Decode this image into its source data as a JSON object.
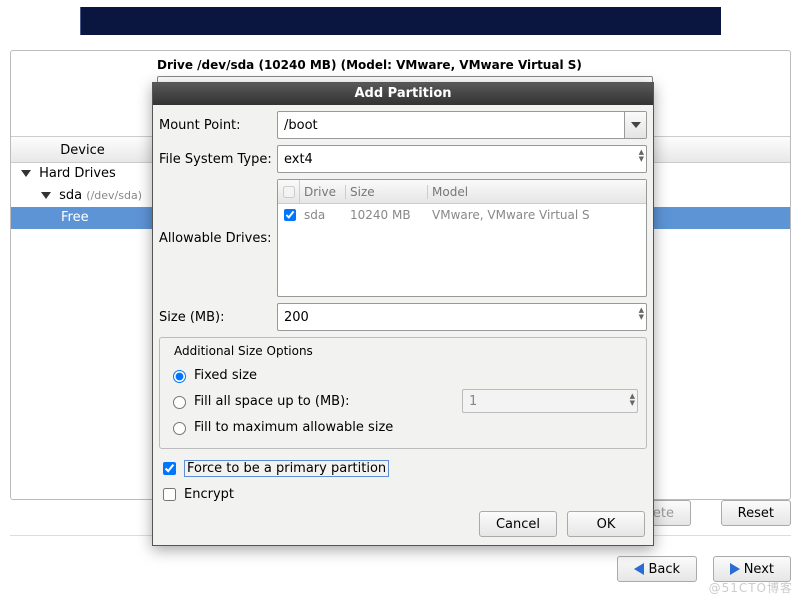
{
  "banner": {},
  "main": {
    "drive_title": "Drive /dev/sda (10240 MB) (Model: VMware, VMware Virtual S)",
    "tree_header": {
      "col1": "Device"
    },
    "tree": {
      "root_label": "Hard Drives",
      "dev_label": "sda",
      "dev_sub": "(/dev/sda)",
      "free_label": "Free"
    },
    "buttons": {
      "delete": "Delete",
      "reset": "Reset",
      "back": "Back",
      "next": "Next"
    }
  },
  "dialog": {
    "title": "Add Partition",
    "labels": {
      "mount_point": "Mount Point:",
      "fs_type": "File System Type:",
      "allowable": "Allowable Drives:",
      "size": "Size (MB):",
      "additional": "Additional Size Options",
      "fixed": "Fixed size",
      "fill_up": "Fill all space up to (MB):",
      "fill_max": "Fill to maximum allowable size",
      "force_primary": "Force to be a primary partition",
      "encrypt": "Encrypt",
      "cancel": "Cancel",
      "ok": "OK"
    },
    "values": {
      "mount_point": "/boot",
      "fs_type": "ext4",
      "size": "200",
      "fill_up_value": "1",
      "size_option": "fixed",
      "force_primary_checked": true,
      "encrypt_checked": false
    },
    "drives_table": {
      "headers": {
        "drive": "Drive",
        "size": "Size",
        "model": "Model"
      },
      "rows": [
        {
          "checked": true,
          "drive": "sda",
          "size": "10240 MB",
          "model": "VMware, VMware Virtual S"
        }
      ]
    }
  },
  "watermark": "@51CTO博客"
}
